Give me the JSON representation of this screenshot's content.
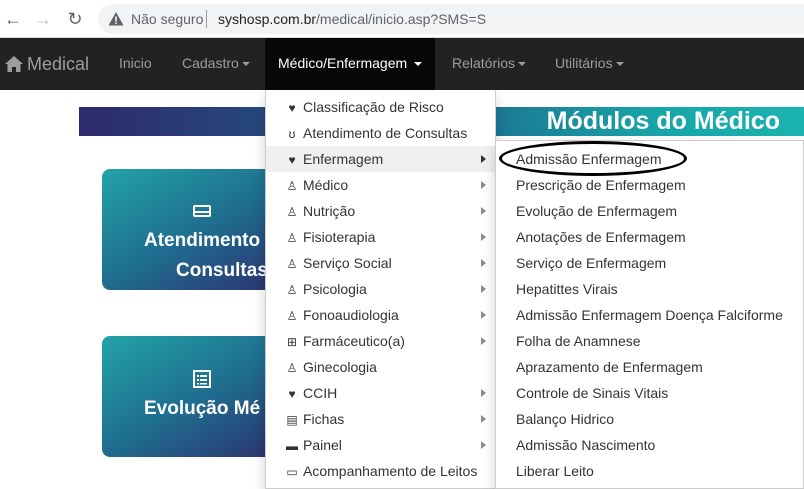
{
  "browser": {
    "security_label": "Não seguro",
    "url_host": "syshosp.com.br",
    "url_path": "/medical/inicio.asp?SMS=S"
  },
  "navbar": {
    "brand": "Medical",
    "items": [
      {
        "label": "Inicio",
        "caret": false
      },
      {
        "label": "Cadastro",
        "caret": true
      },
      {
        "label": "Médico/Enfermagem",
        "caret": true,
        "active": true
      },
      {
        "label": "Relatórios",
        "caret": true
      },
      {
        "label": "Utilitários",
        "caret": true
      }
    ]
  },
  "page": {
    "banner_title": "Módulos do Médico",
    "cards": [
      {
        "line1": "Atendimento",
        "line2": "Consultas",
        "icon": "bed-icon"
      },
      {
        "line1": "Evolução Mé",
        "icon": "list-icon"
      }
    ]
  },
  "menu": {
    "items": [
      {
        "label": "Classificação de Risco",
        "icon": "heartbeat-icon",
        "glyph": "♥",
        "submenu": false
      },
      {
        "label": "Atendimento de Consultas",
        "icon": "stethoscope-icon",
        "glyph": "ʊ",
        "submenu": false
      },
      {
        "label": "Enfermagem",
        "icon": "heart-icon",
        "glyph": "♥",
        "submenu": true,
        "highlighted": true
      },
      {
        "label": "Médico",
        "icon": "user-md-icon",
        "glyph": "♙",
        "submenu": true
      },
      {
        "label": "Nutrição",
        "icon": "user-md-icon",
        "glyph": "♙",
        "submenu": true
      },
      {
        "label": "Fisioterapia",
        "icon": "user-md-icon",
        "glyph": "♙",
        "submenu": true
      },
      {
        "label": "Serviço Social",
        "icon": "user-md-icon",
        "glyph": "♙",
        "submenu": true
      },
      {
        "label": "Psicologia",
        "icon": "user-md-icon",
        "glyph": "♙",
        "submenu": true
      },
      {
        "label": "Fonoaudiologia",
        "icon": "user-md-icon",
        "glyph": "♙",
        "submenu": true
      },
      {
        "label": "Farmáceutico(a)",
        "icon": "medkit-icon",
        "glyph": "⊞",
        "submenu": true
      },
      {
        "label": "Ginecologia",
        "icon": "user-md-icon",
        "glyph": "♙",
        "submenu": false
      },
      {
        "label": "CCIH",
        "icon": "heart-icon",
        "glyph": "♥",
        "submenu": true
      },
      {
        "label": "Fichas",
        "icon": "list-alt-icon",
        "glyph": "▤",
        "submenu": true
      },
      {
        "label": "Painel",
        "icon": "desktop-icon",
        "glyph": "▬",
        "submenu": true
      },
      {
        "label": "Acompanhamento de Leitos",
        "icon": "bed-icon",
        "glyph": "▭",
        "submenu": false
      }
    ]
  },
  "submenu": {
    "items": [
      "Admissão Enfermagem",
      "Prescrição de Enfermagem",
      "Evolução de Enfermagem",
      "Anotações de Enfermagem",
      "Serviço de Enfermagem",
      "Hepatittes Virais",
      "Admissão Enfermagem Doença Falciforme",
      "Folha de Anamnese",
      "Aprazamento de Enfermagem",
      "Controle de Sinais Vitais",
      "Balanço Hidrico",
      "Admissão Nascimento",
      "Liberar Leito"
    ]
  }
}
